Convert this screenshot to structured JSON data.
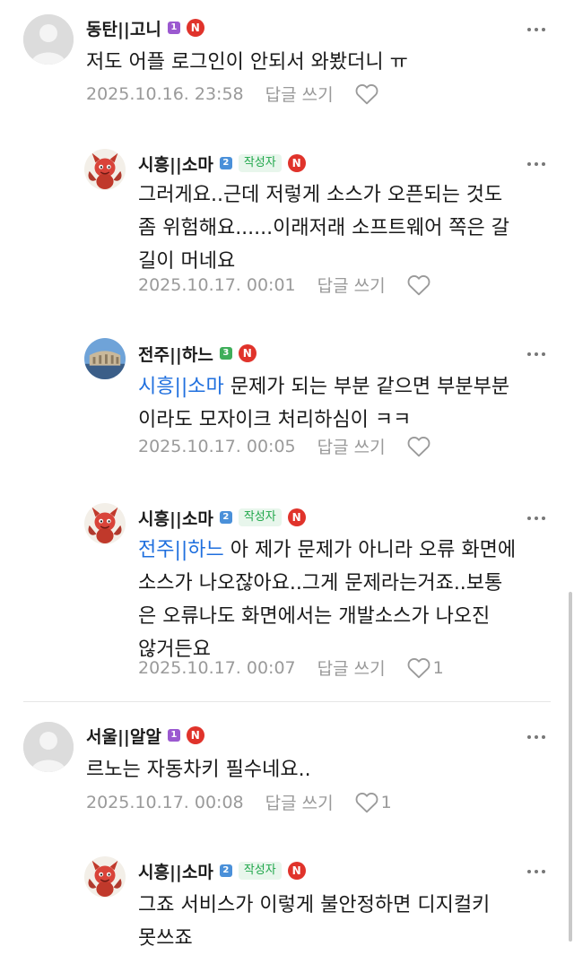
{
  "comments": [
    {
      "nickname": "동탄||고니",
      "level": "1",
      "level_color": "#9b59d0",
      "is_author": false,
      "text": "저도 어플 로그인이 안되서 와봤더니 ㅠ",
      "mention": "",
      "date": "2025.10.16. 23:58",
      "reply_label": "답글 쓰기",
      "likes": ""
    },
    {
      "nickname": "시흥||소마",
      "level": "2",
      "level_color": "#4a90d9",
      "is_author": true,
      "author_label": "작성자",
      "text_lines": [
        "그러게요..근데 저렇게 소스가 오픈되는 것도",
        "좀 위험해요......이래저래 소프트웨어 쪽은 갈",
        "길이 머네요"
      ],
      "date": "2025.10.17. 00:01",
      "reply_label": "답글 쓰기",
      "likes": ""
    },
    {
      "nickname": "전주||하느",
      "level": "3",
      "level_color": "#3fae5a",
      "is_author": false,
      "mention": "시흥||소마",
      "text_lines": [
        " 문제가 되는 부분 같으면 부분부분",
        "이라도 모자이크 처리하심이 ㅋㅋ"
      ],
      "date": "2025.10.17. 00:05",
      "reply_label": "답글 쓰기",
      "likes": ""
    },
    {
      "nickname": "시흥||소마",
      "level": "2",
      "level_color": "#4a90d9",
      "is_author": true,
      "author_label": "작성자",
      "mention": "전주||하느",
      "text_lines": [
        " 아 제가 문제가 아니라 오류 화면에",
        "소스가 나오잖아요..그게 문제라는거죠..보통",
        "은 오류나도 화면에서는 개발소스가 나오진",
        "않거든요"
      ],
      "date": "2025.10.17. 00:07",
      "reply_label": "답글 쓰기",
      "likes": "1"
    },
    {
      "nickname": "서울||알알",
      "level": "1",
      "level_color": "#9b59d0",
      "is_author": false,
      "text": "르노는 자동차키 필수네요..",
      "mention": "",
      "date": "2025.10.17. 00:08",
      "reply_label": "답글 쓰기",
      "likes": "1"
    },
    {
      "nickname": "시흥||소마",
      "level": "2",
      "level_color": "#4a90d9",
      "is_author": true,
      "author_label": "작성자",
      "text_lines": [
        "그죠 서비스가 이렇게 불안정하면 디지컬키",
        "못쓰죠"
      ]
    }
  ],
  "badge_n": "N",
  "icons": {
    "more": "more-dots-icon",
    "heart": "heart-icon",
    "level": "level-badge-icon",
    "naver": "naver-n-icon"
  },
  "colors": {
    "mention": "#1f6fde",
    "author_tag": "#1fa64a",
    "naver_badge": "#e0332b",
    "meta": "#9a9a9a"
  }
}
